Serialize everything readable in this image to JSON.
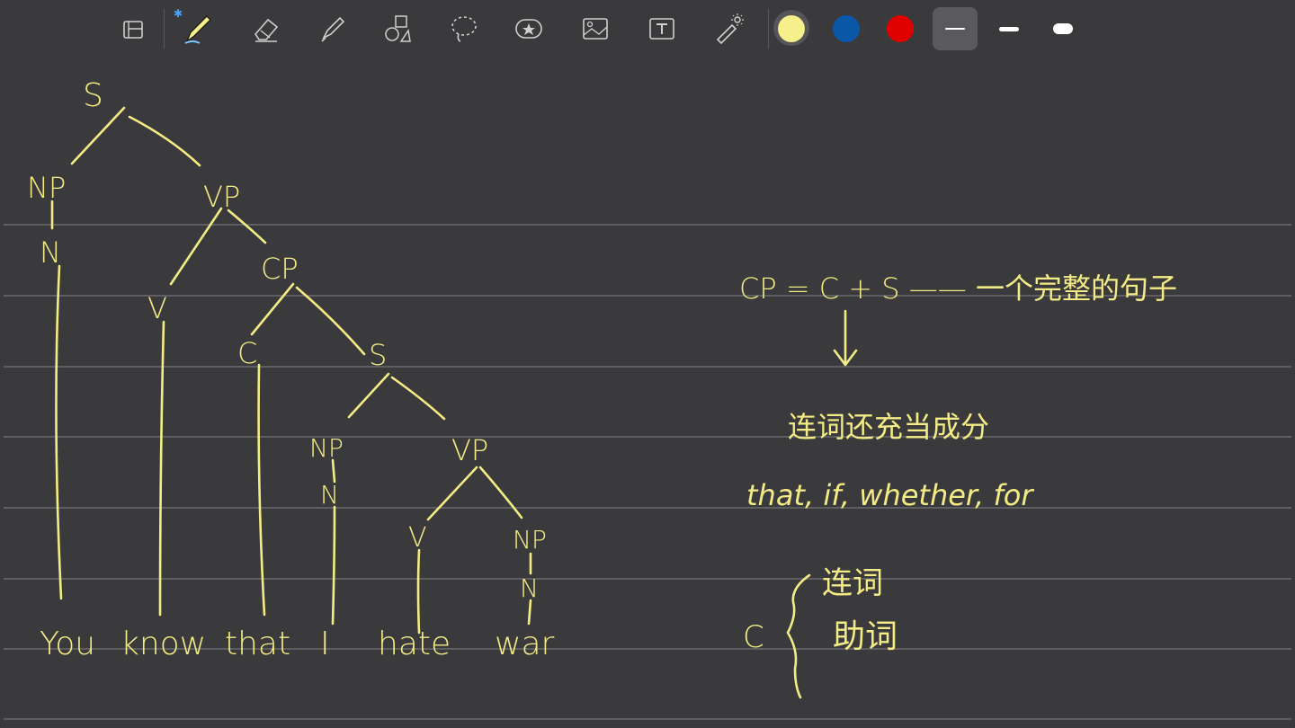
{
  "toolbar": {
    "tools": [
      {
        "name": "page-layout-icon"
      },
      {
        "name": "pen-icon",
        "badge": "bluetooth-icon"
      },
      {
        "name": "eraser-icon"
      },
      {
        "name": "highlighter-icon"
      },
      {
        "name": "shapes-icon"
      },
      {
        "name": "lasso-icon"
      },
      {
        "name": "sticker-icon"
      },
      {
        "name": "image-icon"
      },
      {
        "name": "text-box-icon"
      },
      {
        "name": "laser-pointer-icon"
      }
    ],
    "colors": [
      {
        "name": "color-yellow",
        "hex": "#f6ef8a",
        "selected": true
      },
      {
        "name": "color-blue",
        "hex": "#0a57a8",
        "selected": false
      },
      {
        "name": "color-red",
        "hex": "#e00000",
        "selected": false
      }
    ],
    "stroke_widths": [
      {
        "name": "stroke-width-thin",
        "selected": true
      },
      {
        "name": "stroke-width-medium",
        "selected": false
      },
      {
        "name": "stroke-width-thick",
        "selected": false
      }
    ]
  },
  "note": {
    "ink_color": "#f3ec86",
    "tree": {
      "root": "S",
      "np1": "NP",
      "n1": "N",
      "vp1": "VP",
      "v1": "V",
      "cp": "CP",
      "c": "C",
      "s2": "S",
      "np2": "NP",
      "n2": "N",
      "vp2": "VP",
      "v2": "V",
      "np3": "NP",
      "n3": "N"
    },
    "words": [
      "You",
      "know",
      "that",
      "I",
      "hate",
      "war"
    ],
    "formula": "CP = C + S —— 一个完整的句子",
    "explanation": "连词还充当成分",
    "examples": "that, if, whether, for",
    "c_label": "C",
    "c_items": [
      "连词",
      "助词"
    ]
  }
}
